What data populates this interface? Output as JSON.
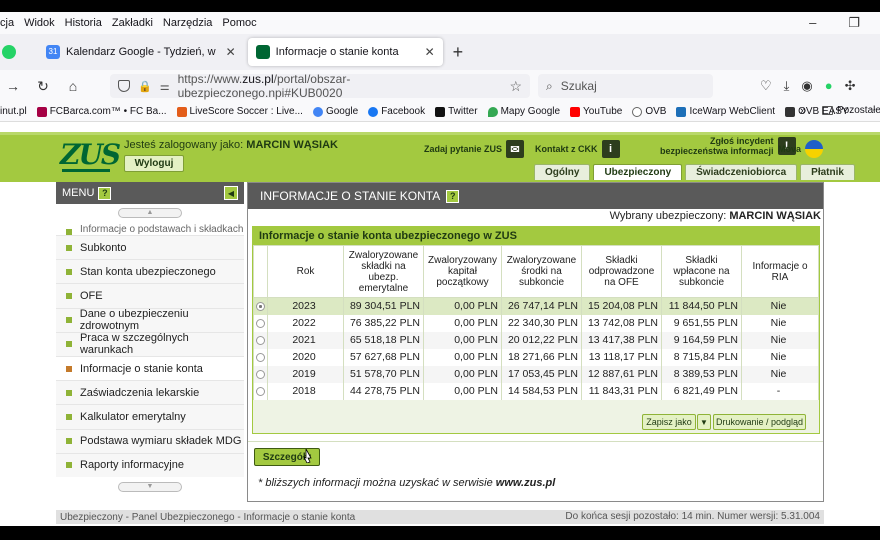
{
  "browser": {
    "menu": [
      "cja",
      "Widok",
      "Historia",
      "Zakładki",
      "Narzędzia",
      "Pomoc"
    ],
    "tabs": [
      {
        "label": "Kalendarz Google - Tydzień, w",
        "active": false
      },
      {
        "label": "Informacje o stanie konta",
        "active": true
      }
    ],
    "url": {
      "prefix": "https://www.",
      "host": "zus.pl",
      "path": "/portal/obszar-ubezpieczonego.npi#KUB0020"
    },
    "search_placeholder": "Szukaj",
    "bookmarks": [
      {
        "label": "inut.pl",
        "color": "#333"
      },
      {
        "label": "FCBarca.com™ • FC Ba...",
        "color": "#a50044"
      },
      {
        "label": "LiveScore Soccer : Live...",
        "color": "#e35d1a"
      },
      {
        "label": "Google",
        "color": "#4285f4"
      },
      {
        "label": "Facebook",
        "color": "#1877f2"
      },
      {
        "label": "Twitter",
        "color": "#111"
      },
      {
        "label": "Mapy Google",
        "color": "#34a853"
      },
      {
        "label": "YouTube",
        "color": "#ff0000"
      },
      {
        "label": "OVB",
        "color": "#666"
      },
      {
        "label": "IceWarp WebClient",
        "color": "#1d6fb8"
      },
      {
        "label": "OVB EASY",
        "color": "#333"
      }
    ],
    "bookmarks_more": "»",
    "bookmarks_folder": "Pozostałe z"
  },
  "header": {
    "logo": "ZUS",
    "logged_prefix": "Jesteś zalogowany jako:",
    "user_name": "MARCIN WĄSIAK",
    "logout": "Wyloguj",
    "ask_question": "Zadaj pytanie ZUS",
    "contact_ckk": "Kontakt z CKK",
    "report_incident_line1": "Zgłoś incydent",
    "report_incident_line2": "bezpieczeństwa informacji",
    "language": "Mova",
    "tabs": [
      {
        "label": "Ogólny",
        "active": false
      },
      {
        "label": "Ubezpieczony",
        "active": true
      },
      {
        "label": "Świadczeniobiorca",
        "active": false
      },
      {
        "label": "Płatnik",
        "active": false
      }
    ]
  },
  "sidebar": {
    "title": "MENU",
    "help": "?",
    "items": [
      {
        "label": "Informacje o podstawach i składkach",
        "active": false,
        "cut": true
      },
      {
        "label": "Subkonto",
        "active": false
      },
      {
        "label": "Stan konta ubezpieczonego",
        "active": false
      },
      {
        "label": "OFE",
        "active": false
      },
      {
        "label": "Dane o ubezpieczeniu zdrowotnym",
        "active": false
      },
      {
        "label": "Praca w szczególnych warunkach",
        "active": false
      },
      {
        "label": "Informacje o stanie konta",
        "active": true
      },
      {
        "label": "Zaświadczenia lekarskie",
        "active": false
      },
      {
        "label": "Kalkulator emerytalny",
        "active": false
      },
      {
        "label": "Podstawa wymiaru składek MDG",
        "active": false
      },
      {
        "label": "Raporty informacyjne",
        "active": false
      }
    ]
  },
  "main": {
    "title": "INFORMACJE O STANIE KONTA",
    "help": "?",
    "selected_label": "Wybrany ubezpieczony:",
    "selected_name": "MARCIN WĄSIAK",
    "section_title": "Informacje o stanie konta ubezpieczonego w ZUS",
    "columns": [
      "Rok",
      "Zwaloryzowane składki na ubezp. emerytalne",
      "Zwaloryzowany kapitał początkowy",
      "Zwaloryzowane środki na subkoncie",
      "Składki odprowadzone na OFE",
      "Składki wpłacone na subkoncie",
      "Informacje o RIA"
    ],
    "rows": [
      {
        "year": "2023",
        "c1": "89 304,51 PLN",
        "c2": "0,00 PLN",
        "c3": "26 747,14 PLN",
        "c4": "15 204,08 PLN",
        "c5": "11 844,50 PLN",
        "ria": "Nie",
        "selected": true
      },
      {
        "year": "2022",
        "c1": "76 385,22 PLN",
        "c2": "0,00 PLN",
        "c3": "22 340,30 PLN",
        "c4": "13 742,08 PLN",
        "c5": "9 651,55 PLN",
        "ria": "Nie",
        "selected": false
      },
      {
        "year": "2021",
        "c1": "65 518,18 PLN",
        "c2": "0,00 PLN",
        "c3": "20 012,22 PLN",
        "c4": "13 417,38 PLN",
        "c5": "9 164,59 PLN",
        "ria": "Nie",
        "selected": false
      },
      {
        "year": "2020",
        "c1": "57 627,68 PLN",
        "c2": "0,00 PLN",
        "c3": "18 271,66 PLN",
        "c4": "13 118,17 PLN",
        "c5": "8 715,84 PLN",
        "ria": "Nie",
        "selected": false
      },
      {
        "year": "2019",
        "c1": "51 578,70 PLN",
        "c2": "0,00 PLN",
        "c3": "17 053,45 PLN",
        "c4": "12 887,61 PLN",
        "c5": "8 389,53 PLN",
        "ria": "Nie",
        "selected": false
      },
      {
        "year": "2018",
        "c1": "44 278,75 PLN",
        "c2": "0,00 PLN",
        "c3": "14 584,53 PLN",
        "c4": "11 843,31 PLN",
        "c5": "6 821,49 PLN",
        "ria": "-",
        "selected": false
      }
    ],
    "save_as": "Zapisz jako",
    "print": "Drukowanie / podgląd",
    "details": "Szczegóły",
    "note_prefix": "* bliższych informacji można uzyskać w serwisie",
    "note_site": "www.zus.pl"
  },
  "statusbar": {
    "left": "Ubezpieczony - Panel Ubezpieczonego - Informacje o stanie konta",
    "right": "Do końca sesji pozostało: 14 min.   Numer wersji: 5.31.004"
  }
}
